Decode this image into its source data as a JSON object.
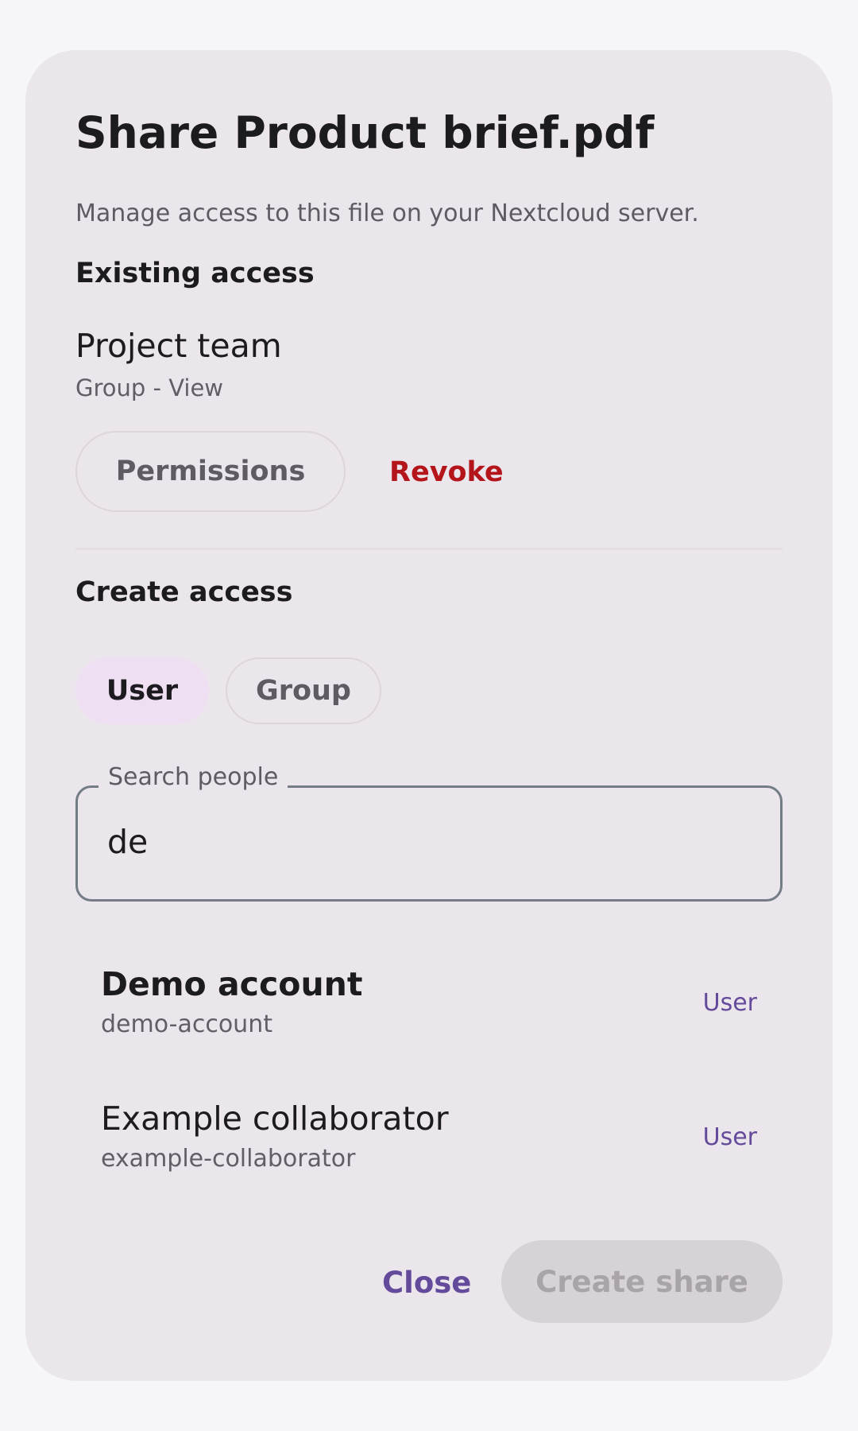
{
  "dialog": {
    "title": "Share Product brief.pdf",
    "subtitle": "Manage access to this file on your Nextcloud server."
  },
  "existing_access": {
    "heading": "Existing access",
    "entries": [
      {
        "name": "Project team",
        "detail": "Group - View",
        "permissions_label": "Permissions",
        "revoke_label": "Revoke"
      }
    ]
  },
  "create_access": {
    "heading": "Create access",
    "type_chips": [
      {
        "label": "User",
        "selected": true
      },
      {
        "label": "Group",
        "selected": false
      }
    ],
    "search": {
      "label": "Search people",
      "value": "de"
    },
    "results": [
      {
        "name": "Demo account",
        "handle": "demo-account",
        "type": "User",
        "highlighted": true
      },
      {
        "name": "Example collaborator",
        "handle": "example-collaborator",
        "type": "User",
        "highlighted": false
      }
    ]
  },
  "actions": {
    "close_label": "Close",
    "create_label": "Create share",
    "create_enabled": false
  },
  "colors": {
    "accent": "#634a9a",
    "danger": "#b3151b",
    "surface": "#ebe6eb",
    "selected_chip": "#efdff2"
  }
}
